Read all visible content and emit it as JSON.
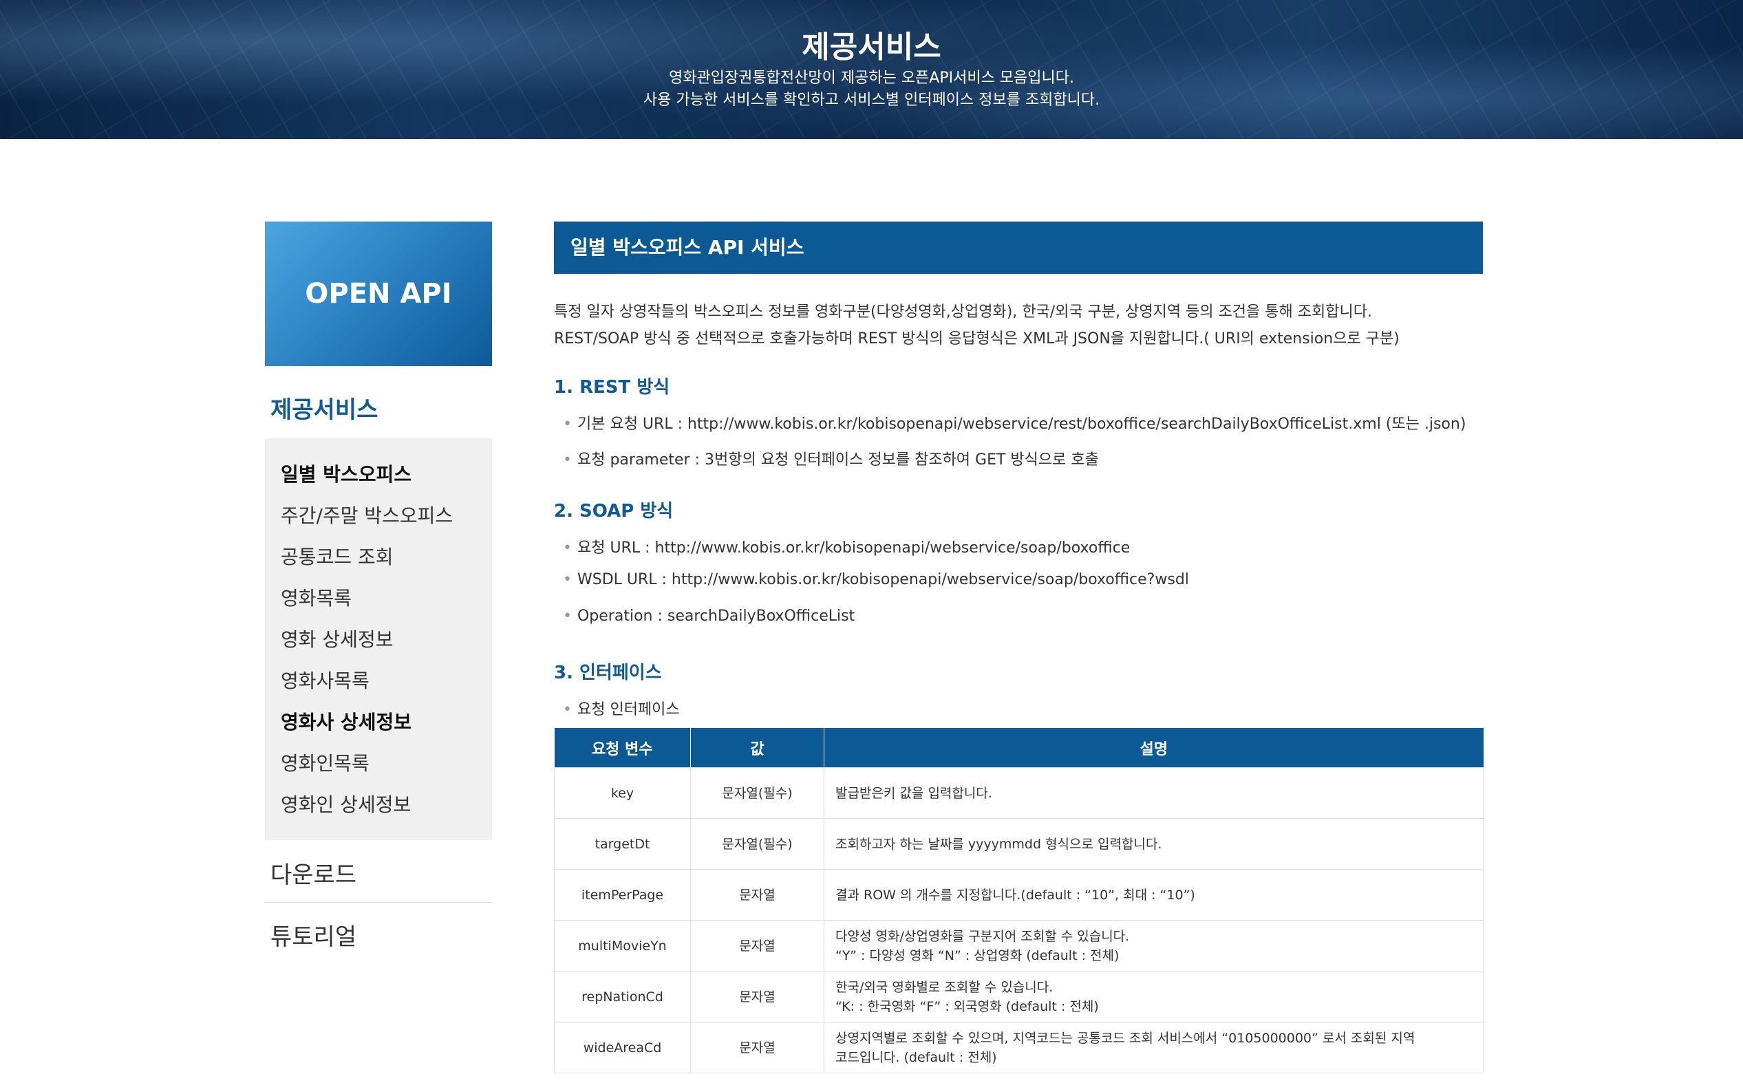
{
  "hero": {
    "title": "제공서비스",
    "desc_line1": "영화관입장권통합전산망이 제공하는 오픈API서비스 모음입니다.",
    "desc_line2": "사용 가능한 서비스를 확인하고 서비스별 인터페이스 정보를 조회합니다."
  },
  "sidebar": {
    "banner": "OPEN API",
    "section_title": "제공서비스",
    "items": [
      {
        "label": "일별 박스오피스"
      },
      {
        "label": "주간/주말 박스오피스"
      },
      {
        "label": "공통코드 조회"
      },
      {
        "label": "영화목록"
      },
      {
        "label": "영화 상세정보"
      },
      {
        "label": "영화사목록"
      },
      {
        "label": "영화사 상세정보"
      },
      {
        "label": "영화인목록"
      },
      {
        "label": "영화인 상세정보"
      }
    ],
    "download": "다운로드",
    "tutorial": "튜토리얼"
  },
  "main": {
    "header": "일별 박스오피스 API 서비스",
    "intro_line1": "특정 일자 상영작들의 박스오피스 정보를 영화구분(다양성영화,상업영화), 한국/외국 구분, 상영지역 등의 조건을 통해 조회합니다.",
    "intro_line2": "REST/SOAP 방식 중 선택적으로 호출가능하며 REST 방식의 응답형식은 XML과 JSON을 지원합니다.( URI의 extension으로 구분)",
    "rest": {
      "title": "1. REST 방식",
      "items": [
        "기본 요청 URL : http://www.kobis.or.kr/kobisopenapi/webservice/rest/boxoffice/searchDailyBoxOfficeList.xml (또는 .json)",
        "요청 parameter : 3번항의 요청 인터페이스 정보를 참조하여 GET 방식으로 호출"
      ]
    },
    "soap": {
      "title": "2. SOAP 방식",
      "items": [
        "요청 URL : http://www.kobis.or.kr/kobisopenapi/webservice/soap/boxoffice",
        "WSDL URL : http://www.kobis.or.kr/kobisopenapi/webservice/soap/boxoffice?wsdl",
        "Operation : searchDailyBoxOfficeList"
      ]
    },
    "interface": {
      "title": "3. 인터페이스",
      "sub": "요청 인터페이스",
      "headers": [
        "요청 변수",
        "값",
        "설명"
      ],
      "rows": [
        {
          "name": "key",
          "value": "문자열(필수)",
          "desc1": "발급받은키 값을 입력합니다.",
          "desc2": ""
        },
        {
          "name": "targetDt",
          "value": "문자열(필수)",
          "desc1": "조회하고자 하는 날짜를 yyyymmdd 형식으로 입력합니다.",
          "desc2": ""
        },
        {
          "name": "itemPerPage",
          "value": "문자열",
          "desc1": "결과 ROW 의 개수를 지정합니다.(default : “10”, 최대 : “10”)",
          "desc2": ""
        },
        {
          "name": "multiMovieYn",
          "value": "문자열",
          "desc1": "다양성 영화/상업영화를 구분지어 조회할 수 있습니다.",
          "desc2": "“Y” : 다양성 영화 “N” : 상업영화 (default : 전체)"
        },
        {
          "name": "repNationCd",
          "value": "문자열",
          "desc1": "한국/외국 영화별로 조회할 수 있습니다.",
          "desc2": "“K: : 한국영화 “F” : 외국영화 (default : 전체)"
        },
        {
          "name": "wideAreaCd",
          "value": "문자열",
          "desc1": "상영지역별로 조회할 수 있으며, 지역코드는 공통코드 조회 서비스에서 “0105000000” 로서 조회된 지역",
          "desc2": "코드입니다. (default : 전체)"
        }
      ]
    }
  }
}
